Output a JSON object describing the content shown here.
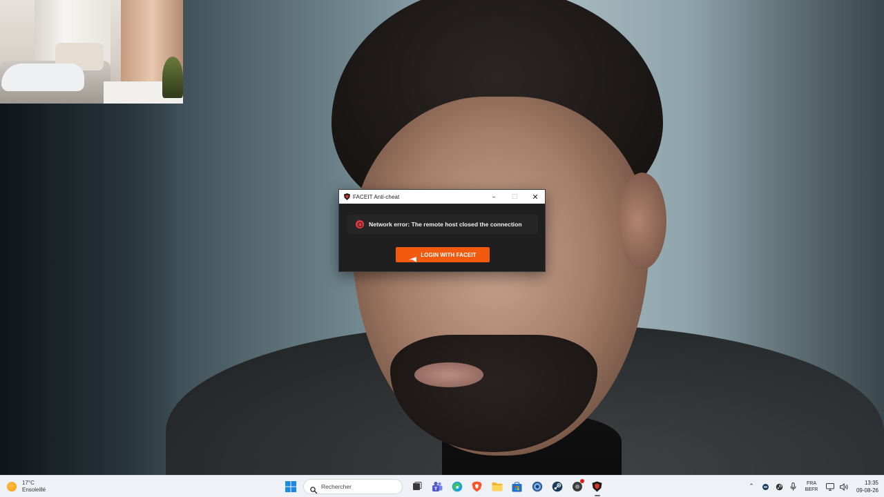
{
  "dialog": {
    "window_title": "FACEIT Anti-cheat",
    "error_message": "Network error: The remote host closed the connection",
    "login_button_label": "LOGIN WITH FACEIT",
    "accent_color": "#f25a0f",
    "error_color": "#e03a3e"
  },
  "taskbar": {
    "weather": {
      "temperature": "17°C",
      "condition": "Ensoleillé",
      "icon": "sun-icon"
    },
    "search": {
      "placeholder": "Rechercher",
      "icon": "search-icon"
    },
    "pinned_apps": [
      {
        "name": "Start",
        "icon": "windows-start-icon"
      },
      {
        "name": "Task View",
        "icon": "task-view-icon"
      },
      {
        "name": "Teams",
        "icon": "teams-icon"
      },
      {
        "name": "Edge",
        "icon": "edge-icon"
      },
      {
        "name": "Brave",
        "icon": "brave-icon"
      },
      {
        "name": "File Explorer",
        "icon": "file-explorer-icon"
      },
      {
        "name": "Microsoft Store",
        "icon": "store-icon"
      },
      {
        "name": "App",
        "icon": "globe-app-icon"
      },
      {
        "name": "Steam",
        "icon": "steam-icon"
      },
      {
        "name": "App with notification",
        "icon": "notification-app-icon"
      },
      {
        "name": "FACEIT Anti-cheat",
        "icon": "faceit-anticheat-icon"
      }
    ],
    "tray": {
      "language_line1": "FRA",
      "language_line2": "BEFR",
      "time": "13:35",
      "date": "09-08-26"
    }
  }
}
